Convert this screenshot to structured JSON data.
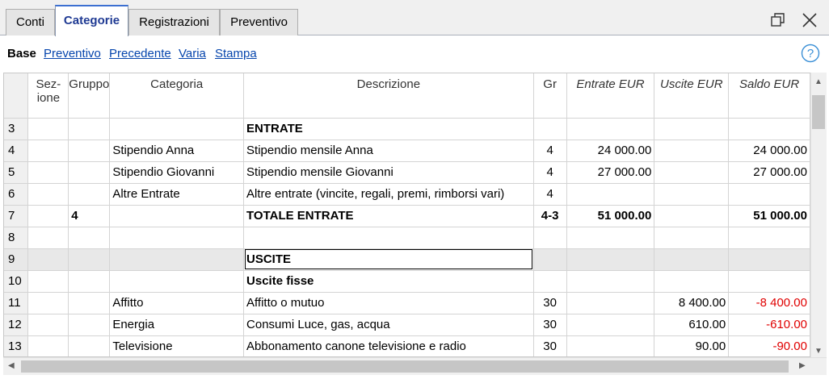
{
  "tabs": [
    {
      "label": "Conti"
    },
    {
      "label": "Categorie"
    },
    {
      "label": "Registrazioni"
    },
    {
      "label": "Preventivo"
    }
  ],
  "window_controls": {
    "restore_icon": "restore-icon",
    "close_icon": "close-icon"
  },
  "views": {
    "active": "Base",
    "links": [
      {
        "label": "Preventivo"
      },
      {
        "label": "Precedente"
      },
      {
        "label": "Varia"
      },
      {
        "label": "Stampa"
      }
    ],
    "help_icon": "help-icon"
  },
  "columns": {
    "sezione_line1": "Sez-",
    "sezione_line2": "ione",
    "gruppo": "Gruppo",
    "categoria": "Categoria",
    "descrizione": "Descrizione",
    "gr": "Gr",
    "entrate": "Entrate EUR",
    "uscite": "Uscite EUR",
    "saldo": "Saldo EUR"
  },
  "rows": [
    {
      "n": "3",
      "sezione": "",
      "gruppo": "",
      "categoria": "",
      "descrizione": "ENTRATE",
      "gr": "",
      "entrate": "",
      "uscite": "",
      "saldo": ""
    },
    {
      "n": "4",
      "sezione": "",
      "gruppo": "",
      "categoria": "Stipendio Anna",
      "descrizione": "Stipendio mensile Anna",
      "gr": "4",
      "entrate": "24 000.00",
      "uscite": "",
      "saldo": "24 000.00"
    },
    {
      "n": "5",
      "sezione": "",
      "gruppo": "",
      "categoria": "Stipendio Giovanni",
      "descrizione": "Stipendio mensile Giovanni",
      "gr": "4",
      "entrate": "27 000.00",
      "uscite": "",
      "saldo": "27 000.00"
    },
    {
      "n": "6",
      "sezione": "",
      "gruppo": "",
      "categoria": "Altre Entrate",
      "descrizione": "Altre entrate (vincite, regali, premi, rimborsi vari)",
      "gr": "4",
      "entrate": "",
      "uscite": "",
      "saldo": ""
    },
    {
      "n": "7",
      "sezione": "",
      "gruppo": "4",
      "categoria": "",
      "descrizione": "TOTALE ENTRATE",
      "gr": "4-3",
      "entrate": "51 000.00",
      "uscite": "",
      "saldo": "51 000.00"
    },
    {
      "n": "8",
      "sezione": "",
      "gruppo": "",
      "categoria": "",
      "descrizione": "",
      "gr": "",
      "entrate": "",
      "uscite": "",
      "saldo": ""
    },
    {
      "n": "9",
      "sezione": "",
      "gruppo": "",
      "categoria": "",
      "descrizione": "USCITE",
      "gr": "",
      "entrate": "",
      "uscite": "",
      "saldo": ""
    },
    {
      "n": "10",
      "sezione": "",
      "gruppo": "",
      "categoria": "",
      "descrizione": "Uscite fisse",
      "gr": "",
      "entrate": "",
      "uscite": "",
      "saldo": ""
    },
    {
      "n": "11",
      "sezione": "",
      "gruppo": "",
      "categoria": "Affitto",
      "descrizione": "Affitto o mutuo",
      "gr": "30",
      "entrate": "",
      "uscite": "8 400.00",
      "saldo": "-8 400.00"
    },
    {
      "n": "12",
      "sezione": "",
      "gruppo": "",
      "categoria": "Energia",
      "descrizione": "Consumi Luce, gas, acqua",
      "gr": "30",
      "entrate": "",
      "uscite": "610.00",
      "saldo": "-610.00"
    },
    {
      "n": "13",
      "sezione": "",
      "gruppo": "",
      "categoria": "Televisione",
      "descrizione": "Abbonamento canone televisione e radio",
      "gr": "30",
      "entrate": "",
      "uscite": "90.00",
      "saldo": "-90.00"
    }
  ],
  "colors": {
    "negative": "#e00000",
    "link": "#0645ad",
    "active_tab": "#1f3a93"
  }
}
